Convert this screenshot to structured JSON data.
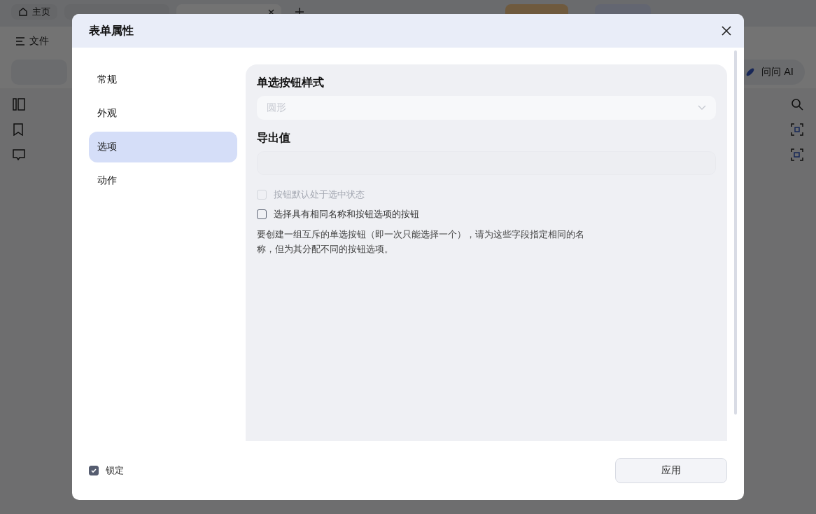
{
  "app": {
    "tabs": [
      {
        "label": "主页",
        "kind": "home",
        "selected": false
      },
      {
        "kind": "doc",
        "selected": false
      },
      {
        "kind": "doc",
        "selected": true
      }
    ],
    "header_buttons": [
      {
        "kind": "buy"
      },
      {
        "kind": "login"
      }
    ],
    "file_menu": "文件",
    "ask_ai": "问问 AI"
  },
  "dialog": {
    "title": "表单属性",
    "nav": [
      {
        "label": "常规",
        "selected": false
      },
      {
        "label": "外观",
        "selected": false
      },
      {
        "label": "选项",
        "selected": true
      },
      {
        "label": "动作",
        "selected": false
      }
    ],
    "radio_style": {
      "label": "单选按钮样式",
      "value": "圆形",
      "disabled": true
    },
    "export_value": {
      "label": "导出值",
      "disabled": true
    },
    "checkboxes": [
      {
        "label": "按钮默认处于选中状态",
        "checked": false,
        "disabled": true
      },
      {
        "label": "选择具有相同名称和按钮选项的按钮",
        "checked": false,
        "disabled": false
      }
    ],
    "note": "要创建一组互斥的单选按钮（即一次只能选择一个），请为这些字段指定相同的名称，但为其分配不同的按钮选项。",
    "lock": {
      "label": "锁定",
      "checked": true
    },
    "apply_button": "应用"
  }
}
